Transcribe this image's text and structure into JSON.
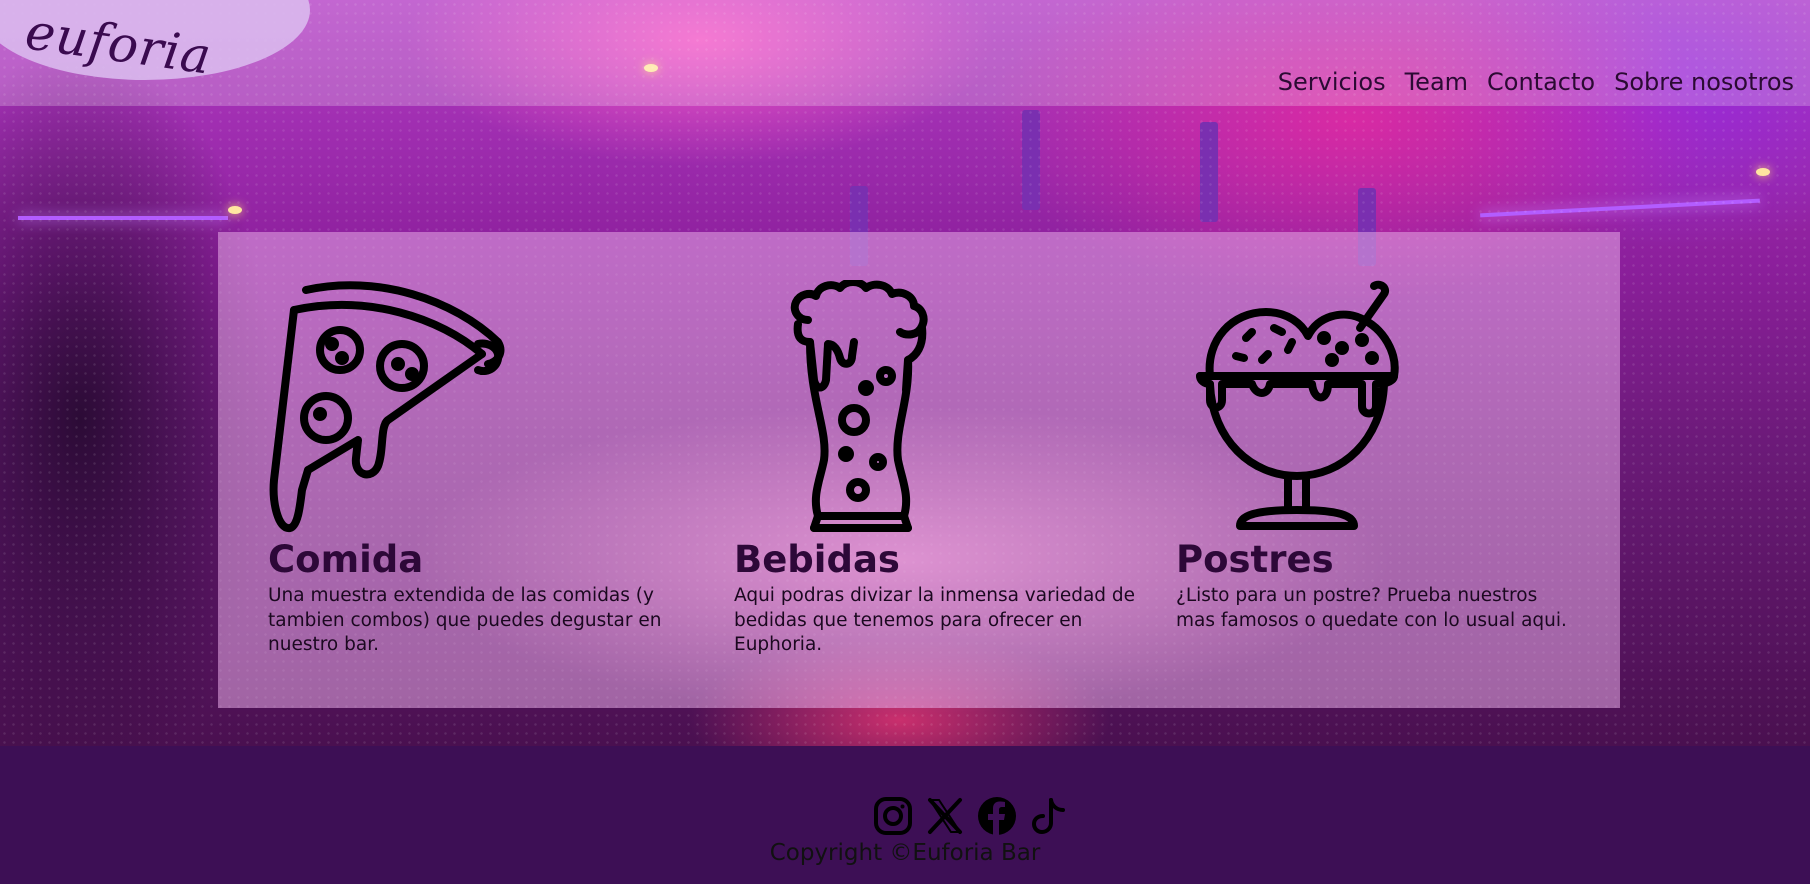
{
  "header": {
    "logo_text": "euforia",
    "nav": [
      {
        "label": "Servicios"
      },
      {
        "label": "Team"
      },
      {
        "label": "Contacto"
      },
      {
        "label": "Sobre nosotros"
      }
    ]
  },
  "services": [
    {
      "icon": "pizza-slice-icon",
      "title": "Comida",
      "description": "Una muestra extendida de las comidas (y tambien combos) que puedes degustar en nuestro bar."
    },
    {
      "icon": "beer-glass-icon",
      "title": "Bebidas",
      "description": "Aqui podras divizar la inmensa variedad de bedidas que tenemos para ofrecer en Euphoria."
    },
    {
      "icon": "ice-cream-bowl-icon",
      "title": "Postres",
      "description": "¿Listo para un postre? Prueba nuestros mas famosos o quedate con lo usual aqui."
    }
  ],
  "footer": {
    "social_icons": [
      "instagram-icon",
      "x-icon",
      "facebook-icon",
      "tiktok-icon"
    ],
    "copyright": "Copyright ©Euforia Bar"
  },
  "colors": {
    "footer_bg": "#3d0f55",
    "heading": "#2d0838",
    "panel": "rgba(230,170,230,0.55)"
  }
}
